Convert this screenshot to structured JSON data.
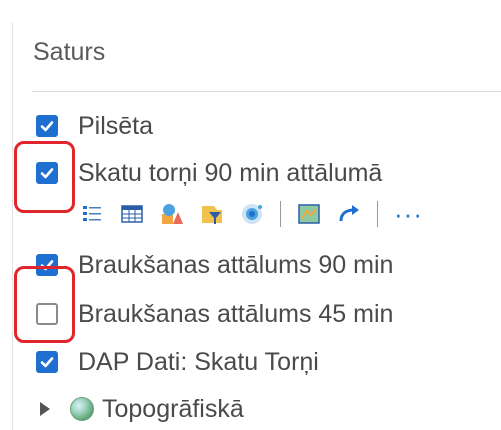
{
  "panel": {
    "title": "Saturs"
  },
  "layers": [
    {
      "label": "Pilsēta",
      "checked": true
    },
    {
      "label": "Skatu torņi 90 min attālumā",
      "checked": true
    },
    {
      "label": "Braukšanas attālums 90 min",
      "checked": true
    },
    {
      "label": "Braukšanas attālums 45 min",
      "checked": false
    },
    {
      "label": "DAP Dati: Skatu Torņi",
      "checked": true
    }
  ],
  "basemap": {
    "label": "Topogrāfiskā",
    "icon": "globe-icon",
    "expanded": false
  },
  "toolbar": {
    "icons": [
      "legend-icon",
      "table-icon",
      "style-icon",
      "filter-icon",
      "cluster-icon",
      "extent-icon",
      "redo-icon"
    ],
    "more_label": "···"
  },
  "colors": {
    "accent": "#1f6fd1",
    "highlight": "#e0262c"
  }
}
